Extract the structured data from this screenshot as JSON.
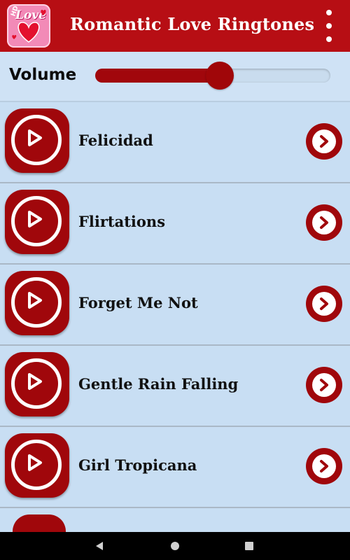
{
  "app": {
    "title": "Romantic Love Ringtones",
    "logo_hd": "HD",
    "logo_text": "Love"
  },
  "volume": {
    "label": "Volume",
    "level": 0.53
  },
  "ringtones": [
    {
      "title": "Felicidad"
    },
    {
      "title": "Flirtations"
    },
    {
      "title": "Forget Me Not"
    },
    {
      "title": "Gentle Rain Falling"
    },
    {
      "title": "Girl Tropicana"
    }
  ],
  "colors": {
    "primary": "#b70e14",
    "button": "#a0070b",
    "background": "#c8def3"
  },
  "icons": {
    "menu": "more-vert-icon",
    "play": "play-icon",
    "next": "chevron-right-icon",
    "nav_back": "back-triangle-icon",
    "nav_home": "home-circle-icon",
    "nav_recent": "recent-square-icon"
  }
}
